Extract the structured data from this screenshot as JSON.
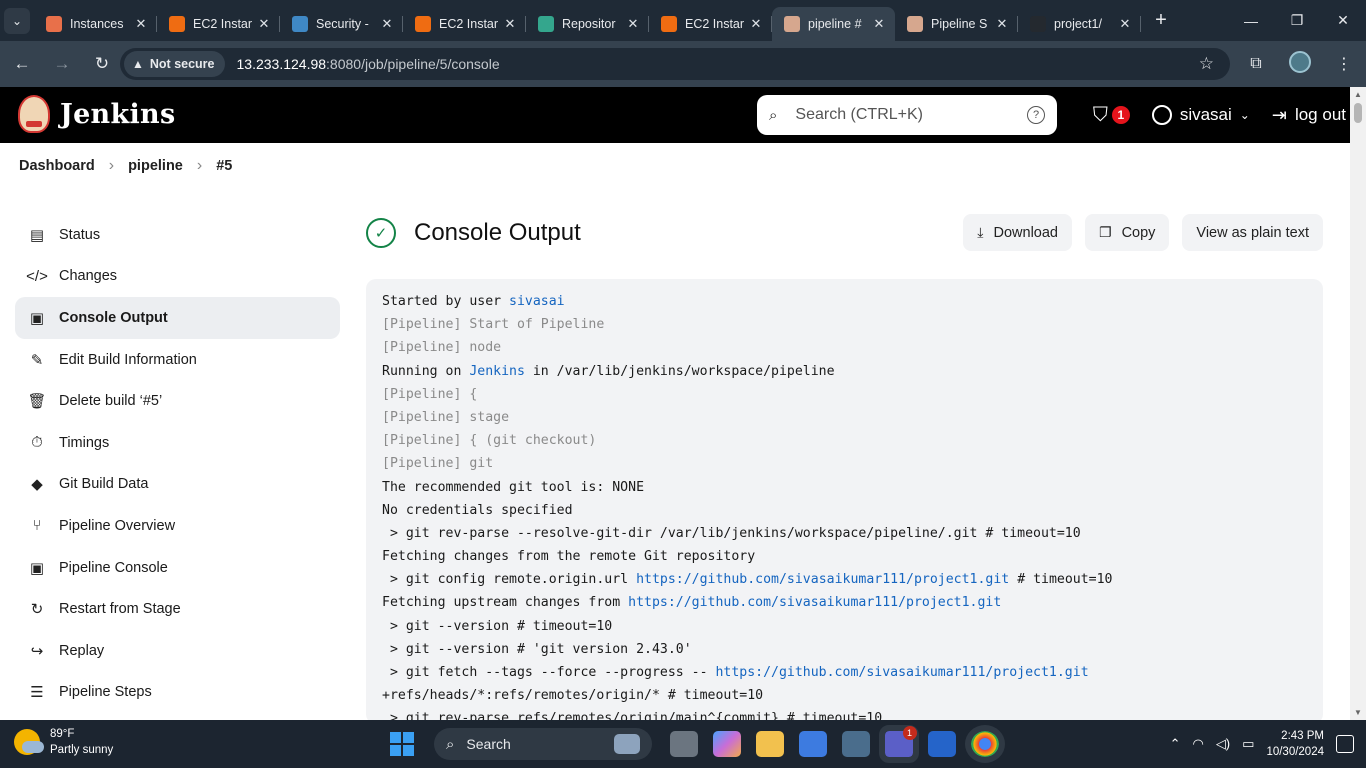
{
  "browser": {
    "tabs": [
      {
        "title": "Instances",
        "color": "#e8704a"
      },
      {
        "title": "EC2 Instar",
        "color": "#ef6c12"
      },
      {
        "title": "Security -",
        "color": "#3f88c5"
      },
      {
        "title": "EC2 Instar",
        "color": "#ef6c12"
      },
      {
        "title": "Repositor",
        "color": "#34a68d"
      },
      {
        "title": "EC2 Instar",
        "color": "#ef6c12"
      },
      {
        "title": "pipeline #",
        "color": "#d6a78e",
        "active": true
      },
      {
        "title": "Pipeline S",
        "color": "#d6a78e"
      },
      {
        "title": "project1/",
        "color": "#24292f"
      }
    ],
    "not_secure_label": "Not secure",
    "url_host": "13.233.124.98",
    "url_path": ":8080/job/pipeline/5/console"
  },
  "jenkins": {
    "brand": "Jenkins",
    "search_placeholder": "Search (CTRL+K)",
    "security_count": "1",
    "username": "sivasai",
    "logout_label": "log out"
  },
  "breadcrumb": [
    "Dashboard",
    "pipeline",
    "#5"
  ],
  "sidebar": {
    "items": [
      {
        "label": "Status",
        "icon": "document-icon",
        "glyph": "▤"
      },
      {
        "label": "Changes",
        "icon": "code-icon",
        "glyph": "</>"
      },
      {
        "label": "Console Output",
        "icon": "terminal-icon",
        "glyph": "▣",
        "active": true
      },
      {
        "label": "Edit Build Information",
        "icon": "edit-icon",
        "glyph": "✎"
      },
      {
        "label": "Delete build ‘#5’",
        "icon": "trash-icon",
        "glyph": "🗑"
      },
      {
        "label": "Timings",
        "icon": "stopwatch-icon",
        "glyph": "⏱"
      },
      {
        "label": "Git Build Data",
        "icon": "git-icon",
        "glyph": "◆"
      },
      {
        "label": "Pipeline Overview",
        "icon": "branch-icon",
        "glyph": "⑂"
      },
      {
        "label": "Pipeline Console",
        "icon": "terminal-icon",
        "glyph": "▣"
      },
      {
        "label": "Restart from Stage",
        "icon": "restart-icon",
        "glyph": "↻"
      },
      {
        "label": "Replay",
        "icon": "replay-icon",
        "glyph": "↪"
      },
      {
        "label": "Pipeline Steps",
        "icon": "list-icon",
        "glyph": "☰"
      }
    ]
  },
  "main": {
    "title": "Console Output",
    "actions": {
      "download": "Download",
      "copy": "Copy",
      "plain": "View as plain text"
    },
    "console_lines": [
      {
        "text": "Started by user ",
        "link": "sivasai"
      },
      {
        "text": "[Pipeline] Start of Pipeline",
        "pipe": true
      },
      {
        "text": "[Pipeline] node",
        "pipe": true
      },
      {
        "text": "Running on ",
        "link": "Jenkins",
        "after": " in /var/lib/jenkins/workspace/pipeline"
      },
      {
        "text": "[Pipeline] {",
        "pipe": true
      },
      {
        "text": "[Pipeline] stage",
        "pipe": true
      },
      {
        "text": "[Pipeline] { (git checkout)",
        "pipe": true
      },
      {
        "text": "[Pipeline] git",
        "pipe": true
      },
      {
        "text": "The recommended git tool is: NONE"
      },
      {
        "text": "No credentials specified"
      },
      {
        "text": " > git rev-parse --resolve-git-dir /var/lib/jenkins/workspace/pipeline/.git # timeout=10"
      },
      {
        "text": "Fetching changes from the remote Git repository"
      },
      {
        "text": " > git config remote.origin.url ",
        "link": "https://github.com/sivasaikumar111/project1.git",
        "after": " # timeout=10"
      },
      {
        "text": "Fetching upstream changes from ",
        "link": "https://github.com/sivasaikumar111/project1.git"
      },
      {
        "text": " > git --version # timeout=10"
      },
      {
        "text": " > git --version # 'git version 2.43.0'"
      },
      {
        "text": " > git fetch --tags --force --progress -- ",
        "link": "https://github.com/sivasaikumar111/project1.git"
      },
      {
        "text": "+refs/heads/*:refs/remotes/origin/* # timeout=10"
      },
      {
        "text": " > git rev-parse refs/remotes/origin/main^{commit} # timeout=10"
      }
    ]
  },
  "taskbar": {
    "temperature": "89°F",
    "weather": "Partly sunny",
    "search_label": "Search",
    "teams_badge": "1",
    "time": "2:43 PM",
    "date": "10/30/2024"
  }
}
